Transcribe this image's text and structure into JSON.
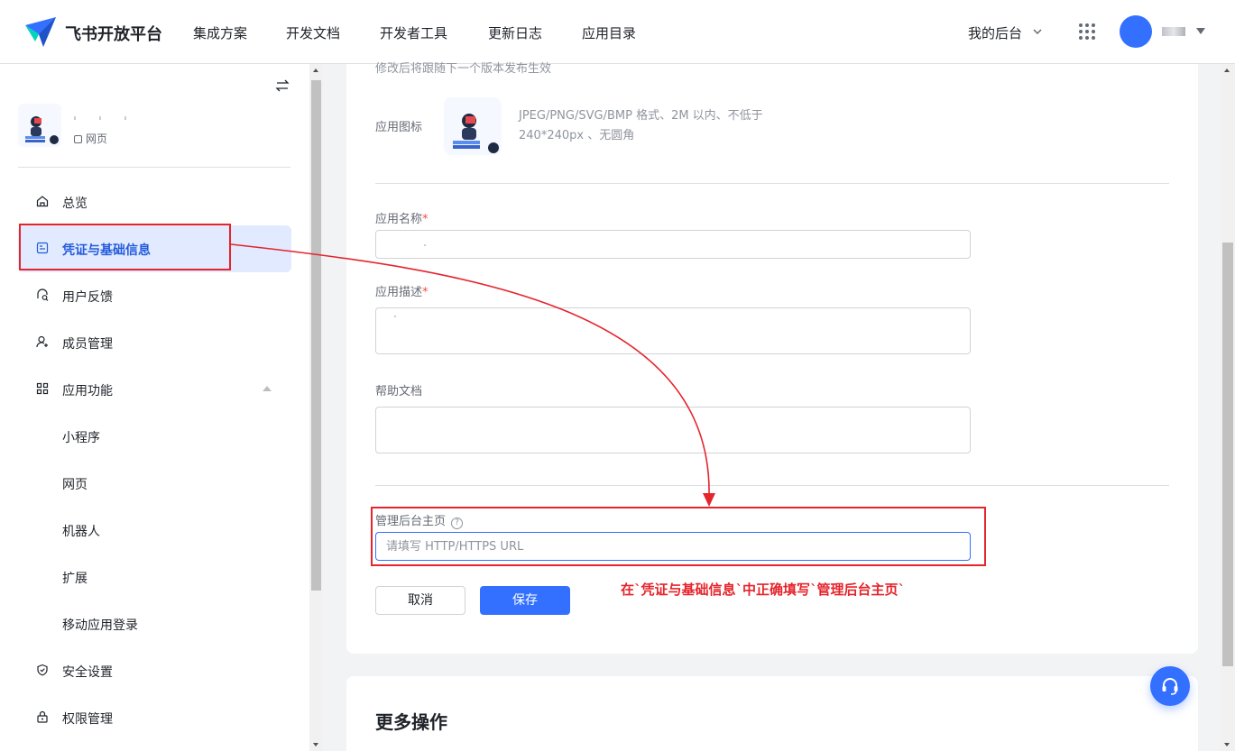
{
  "header": {
    "brand": "飞书开放平台",
    "nav": [
      "集成方案",
      "开发文档",
      "开发者工具",
      "更新日志",
      "应用目录"
    ],
    "console_label": "我的后台",
    "accent": "#3370ff"
  },
  "sidebar": {
    "app_type": "网页",
    "items": [
      {
        "label": "总览",
        "icon": "home-icon"
      },
      {
        "label": "凭证与基础信息",
        "icon": "credential-icon",
        "active": true
      },
      {
        "label": "用户反馈",
        "icon": "feedback-icon"
      },
      {
        "label": "成员管理",
        "icon": "add-member-icon"
      },
      {
        "label": "应用功能",
        "icon": "grid-icon",
        "expanded": true
      },
      {
        "label": "小程序"
      },
      {
        "label": "网页"
      },
      {
        "label": "机器人"
      },
      {
        "label": "扩展"
      },
      {
        "label": "移动应用登录"
      },
      {
        "label": "安全设置",
        "icon": "shield-icon"
      },
      {
        "label": "权限管理",
        "icon": "lock-icon"
      }
    ]
  },
  "form": {
    "cut_text": "修改后将跟随下一个版本发布生效",
    "app_icon_label": "应用图标",
    "app_icon_hint": "JPEG/PNG/SVG/BMP 格式、2M 以内、不低于 240*240px 、无圆角",
    "name_label": "应用名称",
    "desc_label": "应用描述",
    "required_mark": "*",
    "help_doc_label": "帮助文档",
    "admin_home_label": "管理后台主页",
    "help_mark": "?",
    "admin_home_placeholder": "请填写 HTTP/HTTPS URL",
    "cancel_label": "取消",
    "save_label": "保存"
  },
  "more": {
    "title": "更多操作"
  },
  "annotation": {
    "text": "在`凭证与基础信息`中正确填写`管理后台主页`",
    "color": "#e5242b"
  }
}
